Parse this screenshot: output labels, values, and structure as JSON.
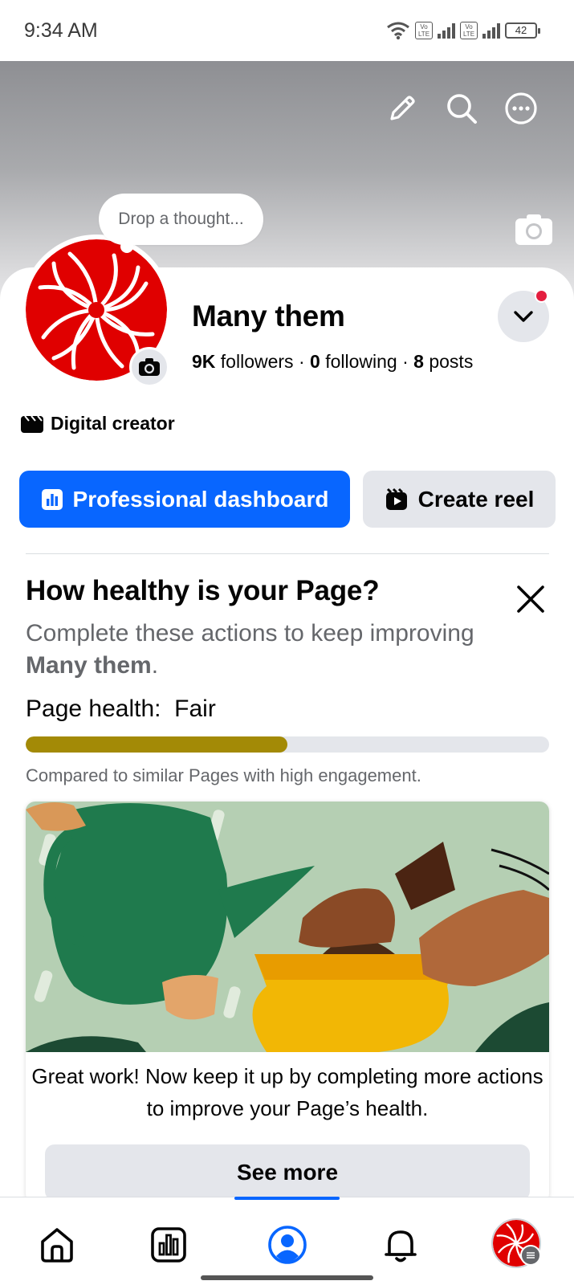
{
  "status_bar": {
    "time": "9:34 AM",
    "battery": "42"
  },
  "cover": {
    "icons": [
      "pencil-icon",
      "search-icon",
      "more-icon",
      "camera-icon"
    ]
  },
  "profile": {
    "thought_placeholder": "Drop a thought...",
    "name": "Many them",
    "followers_count": "9K",
    "followers_label": "followers",
    "following_count": "0",
    "following_label": "following",
    "posts_count": "8",
    "posts_label": "posts",
    "separator": "·",
    "category": "Digital creator"
  },
  "actions": {
    "primary_label": "Professional dashboard",
    "secondary_label": "Create reel"
  },
  "health": {
    "title": "How healthy is your Page?",
    "subtitle_prefix": "Complete these actions to keep improving ",
    "subtitle_page": "Many them",
    "subtitle_suffix": ".",
    "label": "Page health:",
    "value": "Fair",
    "progress_percent": 50,
    "progress_color": "#a38a06",
    "note": "Compared to similar Pages with high engagement."
  },
  "card": {
    "message": "Great work! Now keep it up by completing more actions to improve your Page’s health.",
    "button_label": "See more"
  },
  "bottom_nav": {
    "items": [
      "home-icon",
      "dashboard-icon",
      "profile-icon",
      "notifications-icon",
      "menu-avatar"
    ],
    "active": "profile-icon",
    "accent": "#0866ff"
  }
}
